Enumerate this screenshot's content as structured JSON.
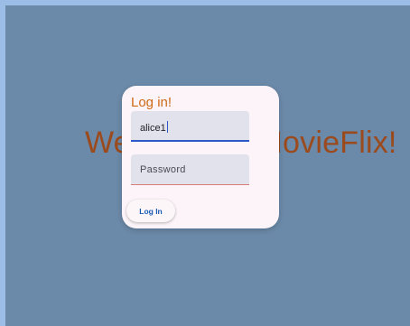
{
  "background": {
    "welcome_text": "Welcome to MovieFlix!"
  },
  "dialog": {
    "title": "Log in!",
    "username": {
      "value": "alice1"
    },
    "password": {
      "placeholder": "Password"
    },
    "login_button_label": "Log In"
  },
  "colors": {
    "window_border": "#9cbde6",
    "background": "#6b89a8",
    "welcome_text": "#9a4a1c",
    "dialog_surface": "#fcf4f8",
    "title": "#cc6a16",
    "field_fill": "#e2e2ec",
    "focus_underline": "#2d58c8",
    "password_underline": "#d87e78",
    "button_text": "#1b5ab3"
  }
}
